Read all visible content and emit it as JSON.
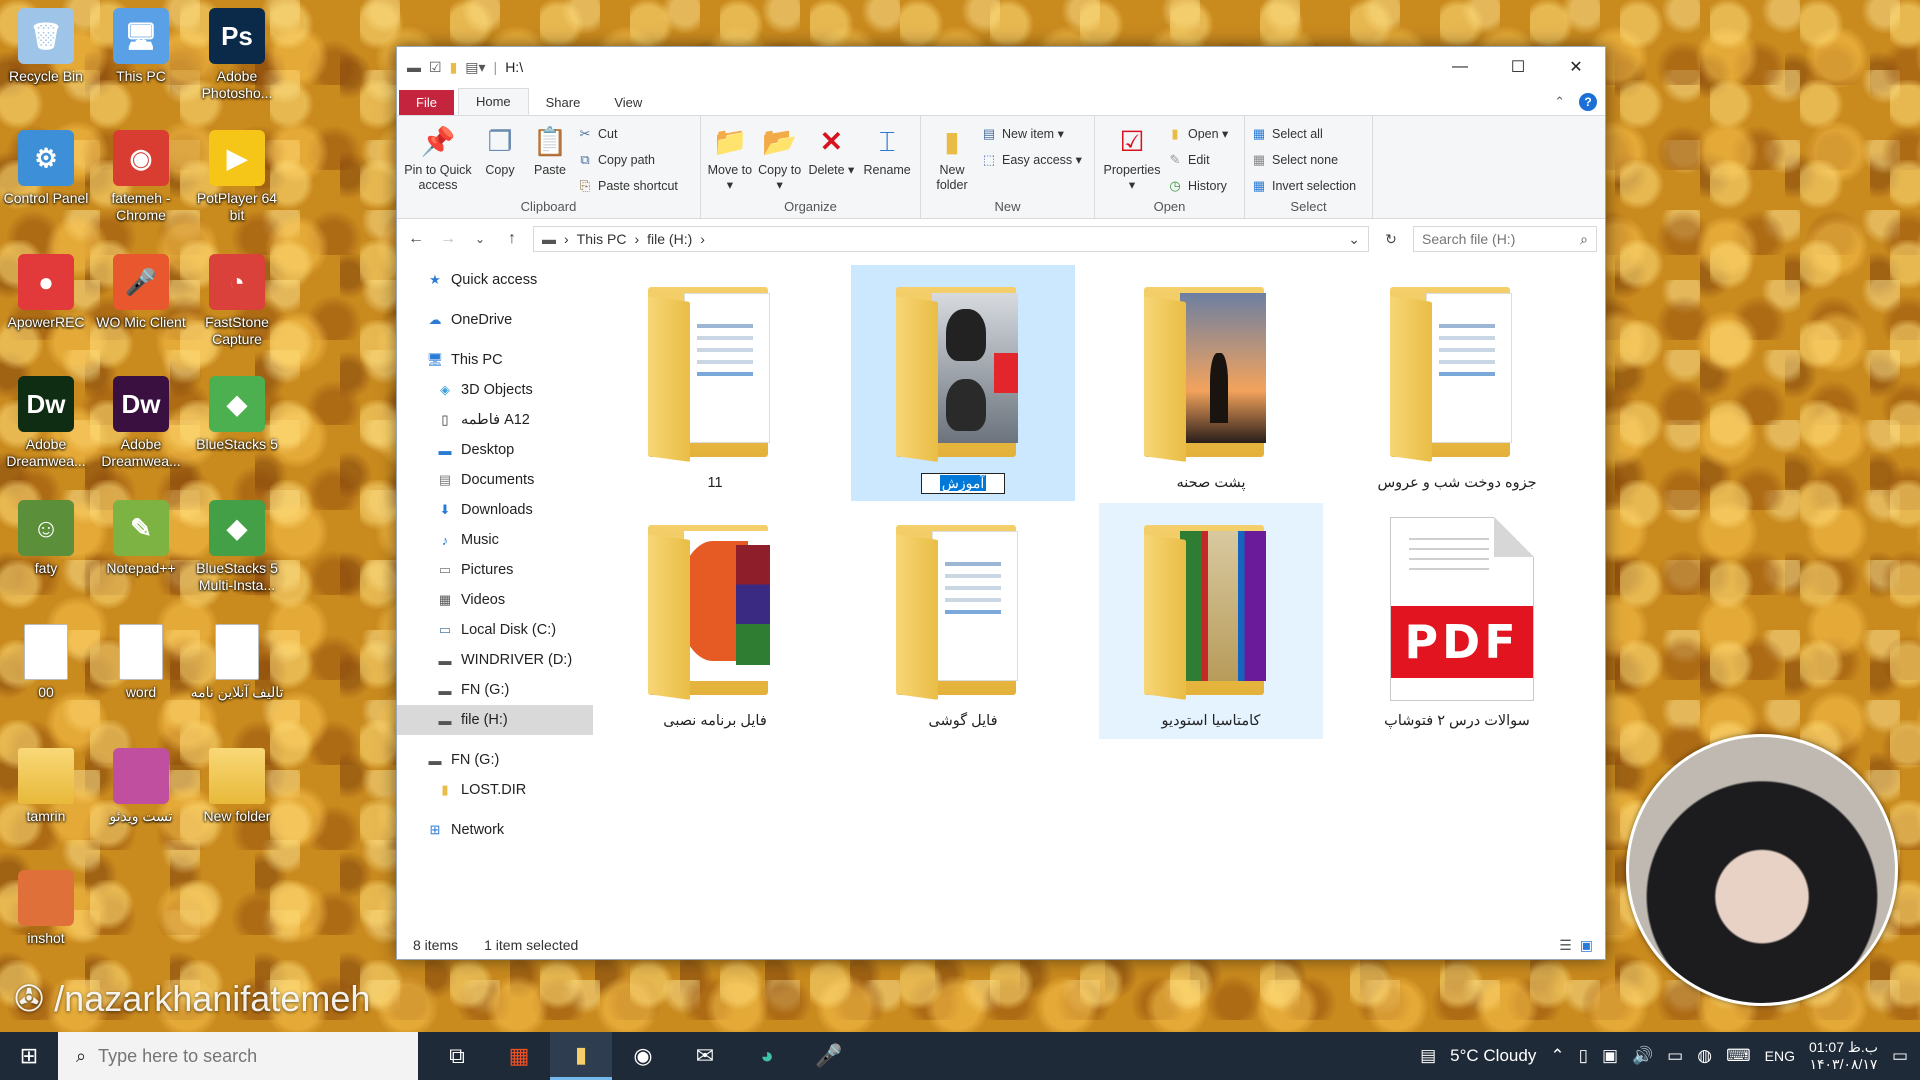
{
  "desktop": {
    "icons": [
      {
        "label": "Recycle Bin",
        "glyph": "🗑",
        "color": "#9ec4e8",
        "icon": "recycle-bin-icon"
      },
      {
        "label": "This PC",
        "glyph": "🖥",
        "color": "#5aa0e6",
        "icon": "this-pc-icon"
      },
      {
        "label": "Adobe Photosho...",
        "glyph": "Ps",
        "color": "#0b2a4a",
        "icon": "photoshop-icon"
      },
      {
        "label": "Control Panel",
        "glyph": "⚙",
        "color": "#3d8fd8",
        "icon": "control-panel-icon"
      },
      {
        "label": "fatemeh - Chrome",
        "glyph": "◉",
        "color": "#d93c30",
        "icon": "chrome-icon"
      },
      {
        "label": "PotPlayer 64 bit",
        "glyph": "▶",
        "color": "#f5c518",
        "icon": "potplayer-icon"
      },
      {
        "label": "ApowerREC",
        "glyph": "●",
        "color": "#e23a3a",
        "icon": "apowerrec-icon"
      },
      {
        "label": "WO Mic Client",
        "glyph": "🎤",
        "color": "#e8572d",
        "icon": "wo-mic-icon"
      },
      {
        "label": "FastStone Capture",
        "glyph": "◔",
        "color": "#d9413a",
        "icon": "faststone-icon"
      },
      {
        "label": "Adobe Dreamwea...",
        "glyph": "Dw",
        "color": "#0f2d12",
        "icon": "dreamweaver-icon"
      },
      {
        "label": "Adobe Dreamwea...",
        "glyph": "Dw",
        "color": "#3a1040",
        "icon": "dreamweaver-icon"
      },
      {
        "label": "BlueStacks 5",
        "glyph": "◆",
        "color": "#4caf50",
        "icon": "bluestacks-icon"
      },
      {
        "label": "faty",
        "glyph": "☺",
        "color": "#5b8f3a",
        "icon": "faty-icon"
      },
      {
        "label": "Notepad++",
        "glyph": "✎",
        "color": "#7cb342",
        "icon": "notepad-icon"
      },
      {
        "label": "BlueStacks 5 Multi-Insta...",
        "glyph": "◆",
        "color": "#43a047",
        "icon": "bluestacks-multi-icon"
      },
      {
        "label": "00",
        "glyph": "",
        "color": "#ffffff",
        "icon": "file-icon"
      },
      {
        "label": "word",
        "glyph": "",
        "color": "#ffffff",
        "icon": "file-icon"
      },
      {
        "label": "تالیف آنلاین نامه",
        "glyph": "",
        "color": "#ffffff",
        "icon": "pdf-file-icon"
      },
      {
        "label": "tamrin",
        "glyph": "",
        "color": "#f0c95a",
        "icon": "folder-icon"
      },
      {
        "label": "تست ویدئو",
        "glyph": "",
        "color": "#c04fa0",
        "icon": "rar-icon"
      },
      {
        "label": "New folder",
        "glyph": "",
        "color": "#f0c95a",
        "icon": "zip-folder-icon"
      },
      {
        "label": "inshot",
        "glyph": "",
        "color": "#e0703a",
        "icon": "inshot-icon"
      }
    ]
  },
  "window": {
    "title": "H:\\",
    "controls": {
      "minimize": "—",
      "maximize": "☐",
      "close": "✕"
    },
    "tabs": [
      "File",
      "Home",
      "Share",
      "View"
    ],
    "help": "?",
    "ribbon": {
      "clipboard": {
        "label": "Clipboard",
        "pin": "Pin to Quick access",
        "copy": "Copy",
        "paste": "Paste",
        "cut": "Cut",
        "copy_path": "Copy path",
        "paste_shortcut": "Paste shortcut"
      },
      "organize": {
        "label": "Organize",
        "move_to": "Move to ▾",
        "copy_to": "Copy to ▾",
        "delete": "Delete ▾",
        "rename": "Rename"
      },
      "new": {
        "label": "New",
        "new_folder": "New folder",
        "new_item": "New item ▾",
        "easy_access": "Easy access ▾"
      },
      "open": {
        "label": "Open",
        "properties": "Properties ▾",
        "open": "Open ▾",
        "edit": "Edit",
        "history": "History"
      },
      "select": {
        "label": "Select",
        "select_all": "Select all",
        "select_none": "Select none",
        "invert": "Invert selection"
      }
    },
    "address": {
      "crumbs": [
        "This PC",
        "file (H:)"
      ],
      "search_placeholder": "Search file (H:)"
    },
    "sidebar": [
      {
        "label": "Quick access",
        "icon": "star-icon",
        "glyph": "★",
        "color": "#2a7bd6",
        "indent": false,
        "gap": false
      },
      {
        "label": "OneDrive",
        "icon": "cloud-icon",
        "glyph": "☁",
        "color": "#2a7bd6",
        "indent": false,
        "gap": true
      },
      {
        "label": "This PC",
        "icon": "this-pc-icon",
        "glyph": "🖥",
        "color": "#2a7bd6",
        "indent": false,
        "gap": true
      },
      {
        "label": "3D Objects",
        "icon": "cube-icon",
        "glyph": "◈",
        "color": "#3aa0e0",
        "indent": true,
        "gap": false
      },
      {
        "label": "فاطمه A12",
        "icon": "phone-icon",
        "glyph": "▯",
        "color": "#333",
        "indent": true,
        "gap": false
      },
      {
        "label": "Desktop",
        "icon": "desktop-icon",
        "glyph": "▬",
        "color": "#2a7bd6",
        "indent": true,
        "gap": false
      },
      {
        "label": "Documents",
        "icon": "document-icon",
        "glyph": "▤",
        "color": "#777",
        "indent": true,
        "gap": false
      },
      {
        "label": "Downloads",
        "icon": "download-icon",
        "glyph": "⬇",
        "color": "#2a7bd6",
        "indent": true,
        "gap": false
      },
      {
        "label": "Music",
        "icon": "music-icon",
        "glyph": "♪",
        "color": "#2a7bd6",
        "indent": true,
        "gap": false
      },
      {
        "label": "Pictures",
        "icon": "pictures-icon",
        "glyph": "▭",
        "color": "#777",
        "indent": true,
        "gap": false
      },
      {
        "label": "Videos",
        "icon": "videos-icon",
        "glyph": "▦",
        "color": "#555",
        "indent": true,
        "gap": false
      },
      {
        "label": "Local Disk (C:)",
        "icon": "drive-icon",
        "glyph": "▭",
        "color": "#4a7ea8",
        "indent": true,
        "gap": false
      },
      {
        "label": "WINDRIVER (D:)",
        "icon": "drive-icon",
        "glyph": "▬",
        "color": "#555",
        "indent": true,
        "gap": false
      },
      {
        "label": "FN (G:)",
        "icon": "drive-icon",
        "glyph": "▬",
        "color": "#555",
        "indent": true,
        "gap": false
      },
      {
        "label": "file (H:)",
        "icon": "drive-icon",
        "glyph": "▬",
        "color": "#555",
        "indent": true,
        "gap": false,
        "selected": true
      },
      {
        "label": "FN (G:)",
        "icon": "drive-icon",
        "glyph": "▬",
        "color": "#555",
        "indent": false,
        "gap": true
      },
      {
        "label": "LOST.DIR",
        "icon": "folder-icon",
        "glyph": "▮",
        "color": "#e9bd45",
        "indent": true,
        "gap": false
      },
      {
        "label": "Network",
        "icon": "network-icon",
        "glyph": "⊞",
        "color": "#2a7bd6",
        "indent": false,
        "gap": true
      }
    ],
    "items": [
      {
        "label": "11",
        "kind": "folder",
        "thumb": "docs",
        "state": ""
      },
      {
        "label": "آموزش",
        "kind": "folder",
        "thumb": "portrait",
        "state": "selected",
        "renaming": true
      },
      {
        "label": "پشت صحنه",
        "kind": "folder",
        "thumb": "sunset",
        "state": ""
      },
      {
        "label": "جزوه دوخت شب و عروس",
        "kind": "folder",
        "thumb": "docs",
        "state": ""
      },
      {
        "label": "فایل برنامه نصبی",
        "kind": "folder",
        "thumb": "office",
        "state": ""
      },
      {
        "label": "فایل گوشی",
        "kind": "folder",
        "thumb": "docs",
        "state": ""
      },
      {
        "label": "کامتاسیا استودیو",
        "kind": "folder",
        "thumb": "rar",
        "state": "hover"
      },
      {
        "label": "سوالات درس ۲ فتوشاپ",
        "kind": "pdf",
        "thumb": "pdf",
        "state": ""
      }
    ],
    "pdf_badge": "PDF",
    "status": {
      "count": "8 items",
      "selection": "1 item selected"
    }
  },
  "watermark": "/nazarkhanifatemeh",
  "taskbar": {
    "search_placeholder": "Type here to search",
    "weather": "5°C  Cloudy",
    "language": "ENG",
    "time": "01:07 ب.ظ",
    "date": "۱۴۰۳/۰۸/۱۷"
  }
}
